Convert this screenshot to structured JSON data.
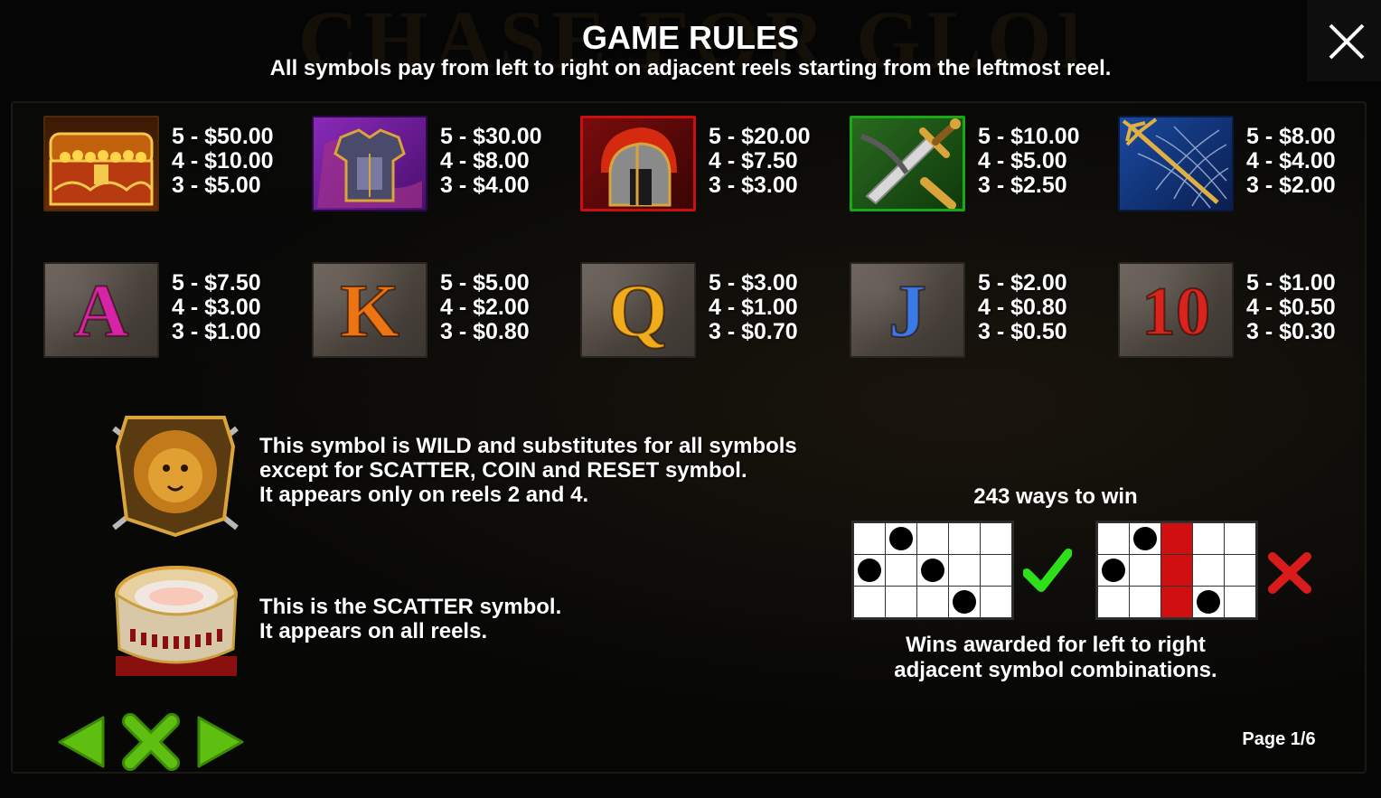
{
  "background_logo": "CHASE FOR GLORY",
  "header": {
    "title": "GAME RULES",
    "subtitle": "All symbols pay from left to right on adjacent reels starting from the leftmost reel."
  },
  "paytable": [
    {
      "symbol": "treasure-chest",
      "lines": [
        "5 - $50.00",
        "4 - $10.00",
        "3 - $5.00"
      ]
    },
    {
      "symbol": "armor",
      "lines": [
        "5 - $30.00",
        "4 - $8.00",
        "3 - $4.00"
      ]
    },
    {
      "symbol": "helmet",
      "lines": [
        "5 - $20.00",
        "4 - $7.50",
        "3 - $3.00"
      ]
    },
    {
      "symbol": "sword",
      "lines": [
        "5 - $10.00",
        "4 - $5.00",
        "3 - $2.50"
      ]
    },
    {
      "symbol": "trident-net",
      "lines": [
        "5 - $8.00",
        "4 - $4.00",
        "3 - $2.00"
      ]
    },
    {
      "symbol": "A",
      "color": "#c21c9c",
      "lines": [
        "5 - $7.50",
        "4 - $3.00",
        "3 - $1.00"
      ]
    },
    {
      "symbol": "K",
      "color": "#e06a10",
      "lines": [
        "5 - $5.00",
        "4 - $2.00",
        "3 - $0.80"
      ]
    },
    {
      "symbol": "Q",
      "color": "#e8a21a",
      "lines": [
        "5 - $3.00",
        "4 - $1.00",
        "3 - $0.70"
      ]
    },
    {
      "symbol": "J",
      "color": "#2f6fd8",
      "lines": [
        "5 - $2.00",
        "4 - $0.80",
        "3 - $0.50"
      ]
    },
    {
      "symbol": "10",
      "color": "#c8201a",
      "lines": [
        "5 - $1.00",
        "4 - $0.50",
        "3 - $0.30"
      ]
    }
  ],
  "wild": {
    "icon": "lion-shield-icon",
    "lines": [
      "This symbol is WILD and substitutes for all symbols",
      "except for SCATTER, COIN and RESET symbol.",
      "It appears only on reels 2 and 4."
    ]
  },
  "scatter": {
    "icon": "colosseum-icon",
    "lines": [
      "This is the SCATTER symbol.",
      "It appears on all reels."
    ]
  },
  "ways": {
    "title": "243 ways to win",
    "caption_lines": [
      "Wins awarded for left to right",
      "adjacent symbol combinations."
    ],
    "valid_example_dots": [
      [
        1,
        0
      ],
      [
        0,
        1
      ],
      [
        2,
        1
      ],
      [
        3,
        2
      ]
    ],
    "invalid_example_dots": [
      [
        1,
        0
      ],
      [
        0,
        1
      ],
      [
        3,
        2
      ]
    ],
    "invalid_example_red_column": 2,
    "valid_mark": "check-icon",
    "invalid_mark": "cross-icon"
  },
  "footer": {
    "page": "Page 1/6"
  },
  "colors": {
    "nav_green": "#5fbf10",
    "check_green": "#2ee01a",
    "cross_red": "#d81c1c"
  }
}
